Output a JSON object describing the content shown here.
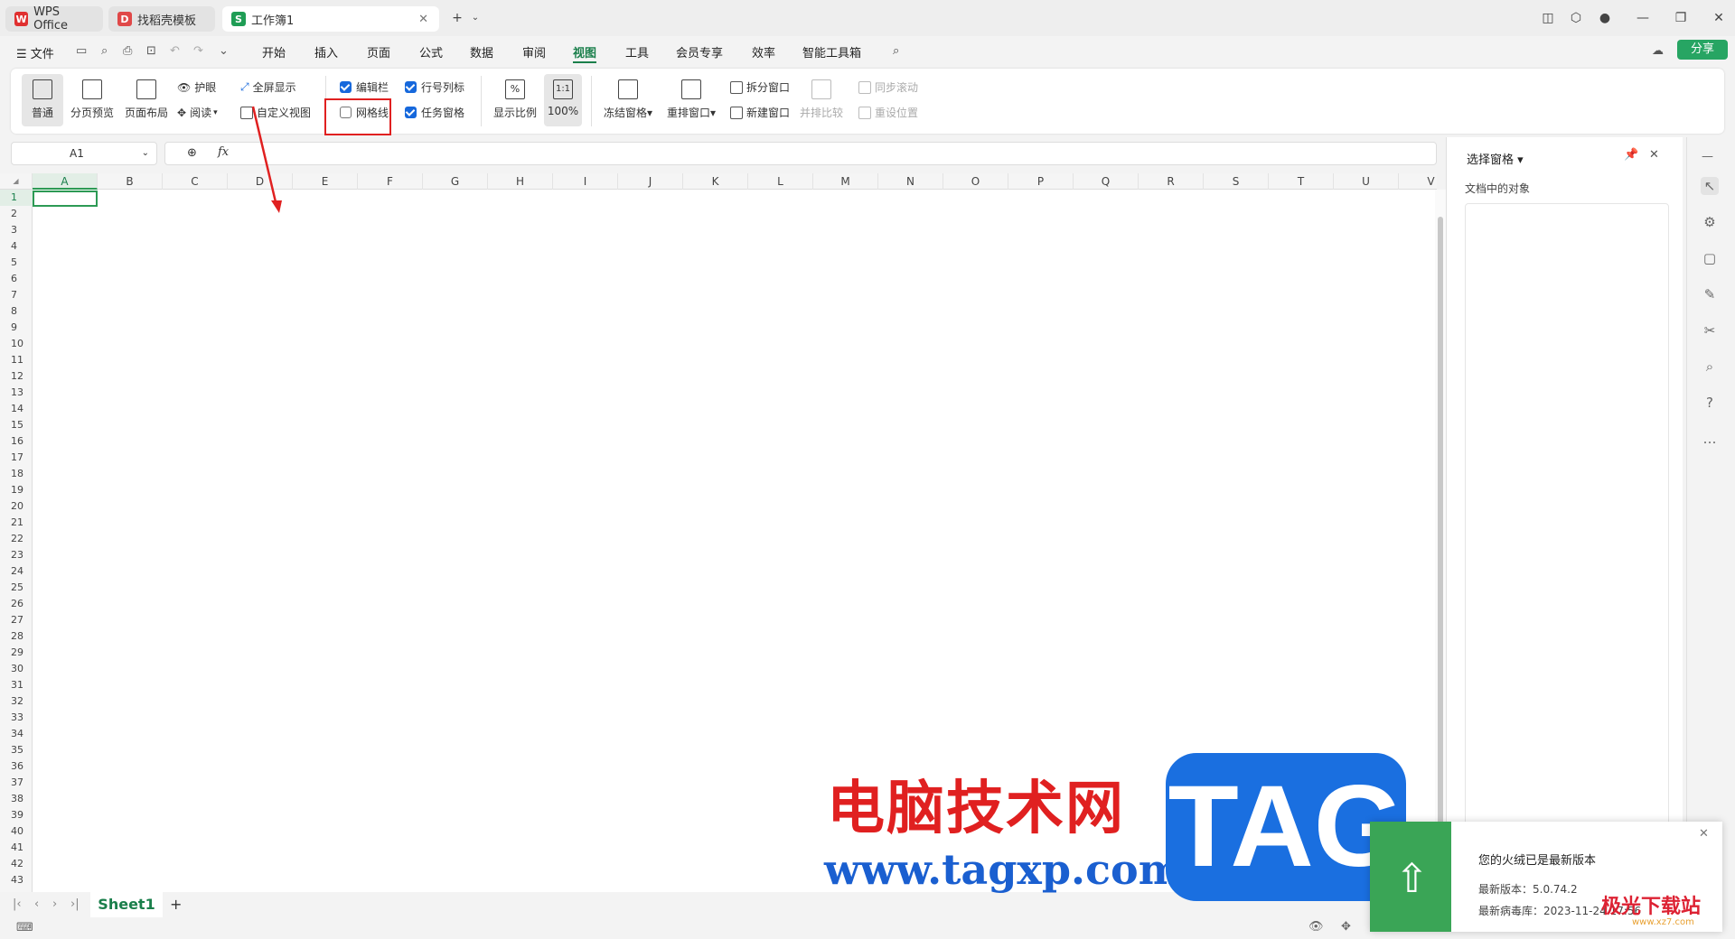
{
  "tabs": [
    {
      "label": "WPS Office"
    },
    {
      "label": "找稻壳模板"
    },
    {
      "label": "工作簿1"
    }
  ],
  "menubar": {
    "file": "文件",
    "items": [
      "开始",
      "插入",
      "页面",
      "公式",
      "数据",
      "审阅",
      "视图",
      "工具",
      "会员专享",
      "效率",
      "智能工具箱"
    ],
    "active": "视图",
    "share": "分享"
  },
  "ribbon": {
    "normal": "普通",
    "page_break": "分页预览",
    "page_layout": "页面布局",
    "eye": "护眼",
    "read": "阅读",
    "fullscreen": "全屏显示",
    "custom_view": "自定义视图",
    "edit_bar": "编辑栏",
    "gridlines": "网格线",
    "row_col_header": "行号列标",
    "task_pane": "任务窗格",
    "zoom": "显示比例",
    "zoom100": "100%",
    "zoom_icon": "1:1",
    "freeze": "冻结窗格",
    "rearrange": "重排窗口",
    "split": "拆分窗口",
    "new_window": "新建窗口",
    "side_by_side": "并排比较",
    "sync_scroll": "同步滚动",
    "reset_pos": "重设位置",
    "checks": {
      "edit_bar": true,
      "gridlines": false,
      "row_col_header": true,
      "task_pane": true
    }
  },
  "formula": {
    "cell": "A1",
    "fx": "fx"
  },
  "columns": [
    "A",
    "B",
    "C",
    "D",
    "E",
    "F",
    "G",
    "H",
    "I",
    "J",
    "K",
    "L",
    "M",
    "N",
    "O",
    "P",
    "Q",
    "R",
    "S",
    "T",
    "U",
    "V"
  ],
  "rows": [
    "1",
    "2",
    "3",
    "4",
    "5",
    "6",
    "7",
    "8",
    "9",
    "10",
    "11",
    "12",
    "13",
    "14",
    "15",
    "16",
    "17",
    "18",
    "19",
    "20",
    "21",
    "22",
    "23",
    "24",
    "25",
    "26",
    "27",
    "28",
    "29",
    "30",
    "31",
    "32",
    "33",
    "34",
    "35",
    "36",
    "37",
    "38",
    "39",
    "40",
    "41",
    "42",
    "43"
  ],
  "sheet": {
    "name": "Sheet1",
    "add": "+"
  },
  "panel": {
    "title": "选择窗格",
    "subtitle": "文档中的对象"
  },
  "toast": {
    "title": "您的火绒已是最新版本",
    "version": "最新版本：5.0.74.2",
    "virus_db": "最新病毒库：2023-11-24 17:56"
  },
  "watermark": {
    "cn": "电脑技术网",
    "url": "www.tagxp.com",
    "tag": "TAG",
    "site2": "极光下载站",
    "site2_url": "www.xz7.com"
  },
  "colors": {
    "accent": "#1a7f4b",
    "checkbox": "#1668dc",
    "highlight": "#e02020",
    "tag": "#1a6fe0"
  }
}
